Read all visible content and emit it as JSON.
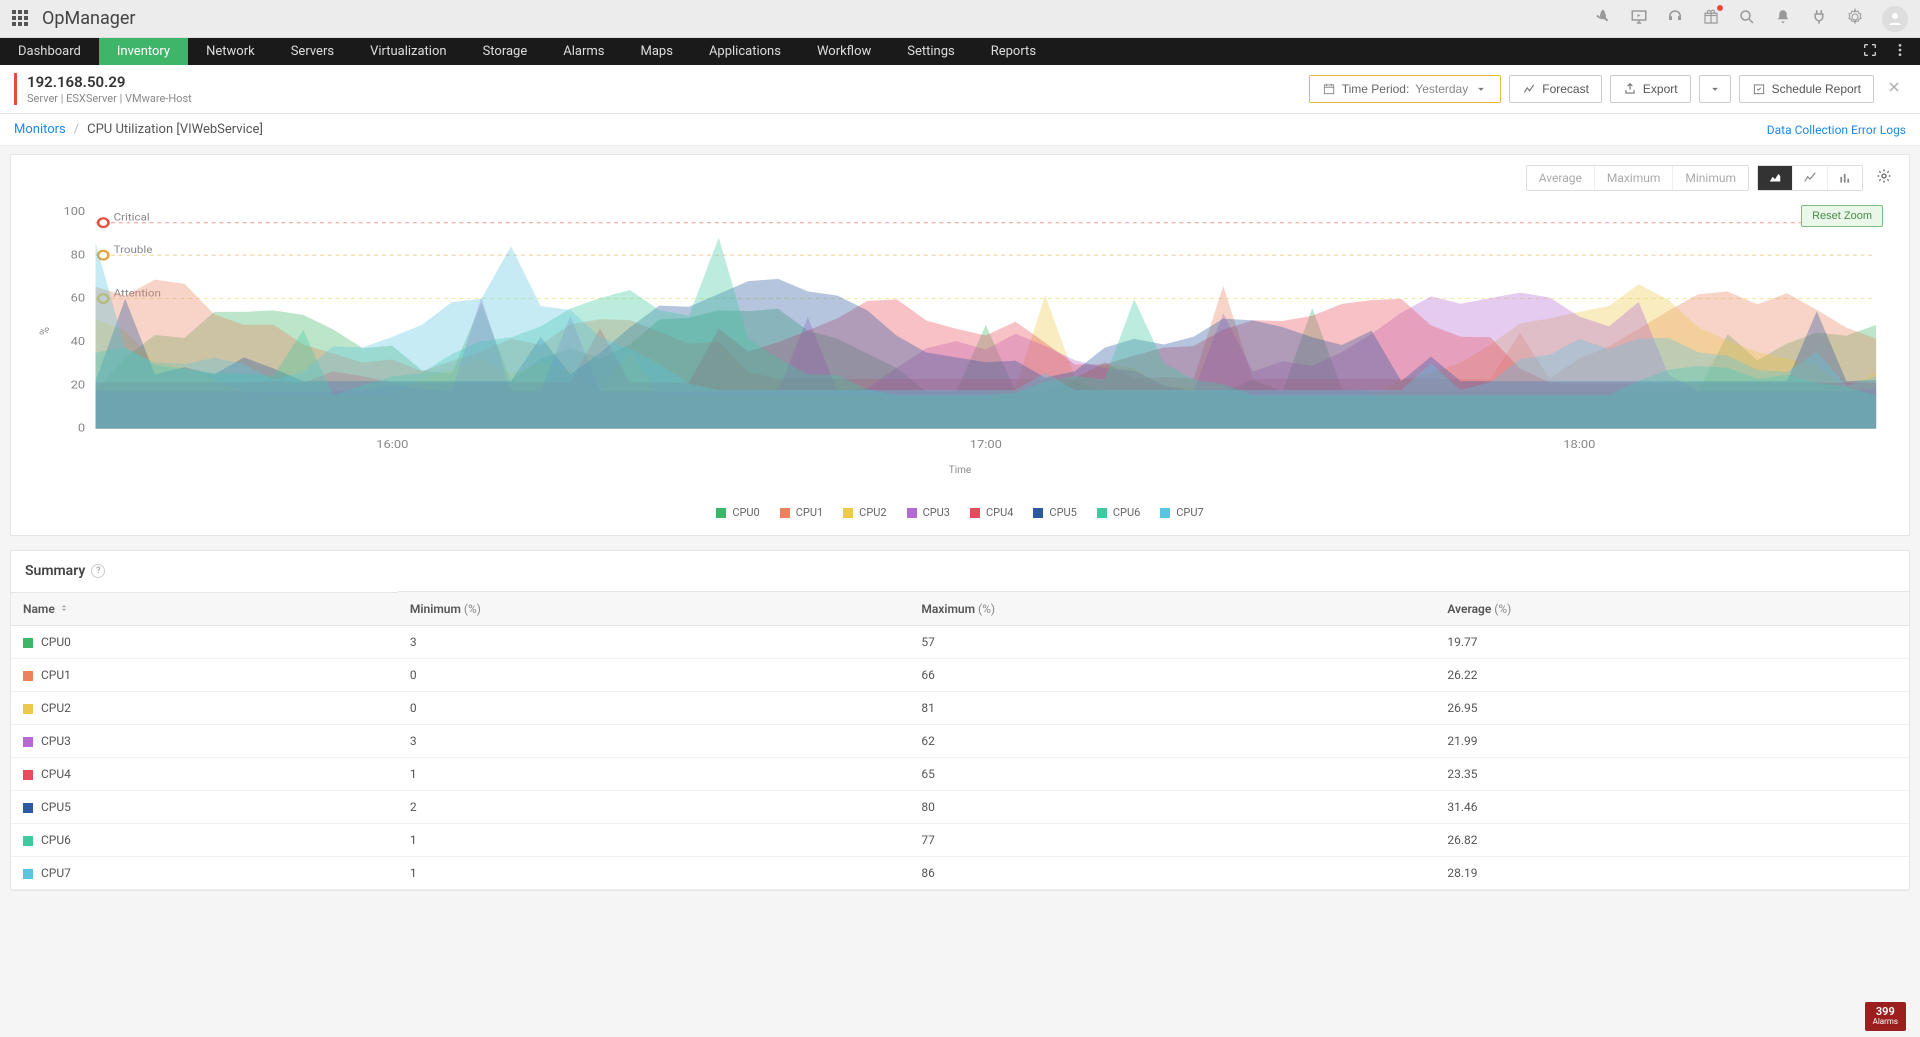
{
  "product_name": "OpManager",
  "nav": {
    "items": [
      "Dashboard",
      "Inventory",
      "Network",
      "Servers",
      "Virtualization",
      "Storage",
      "Alarms",
      "Maps",
      "Applications",
      "Workflow",
      "Settings",
      "Reports"
    ],
    "active_index": 1
  },
  "page_header": {
    "title": "192.168.50.29",
    "subtitle": "Server | ESXServer | VMware-Host",
    "time_period_label": "Time Period:",
    "time_period_value": "Yesterday",
    "forecast_label": "Forecast",
    "export_label": "Export",
    "schedule_label": "Schedule Report"
  },
  "breadcrumb": {
    "root": "Monitors",
    "current": "CPU Utilization [VIWebService]",
    "error_link": "Data Collection Error Logs"
  },
  "chart_toolbar": {
    "stats": [
      "Average",
      "Maximum",
      "Minimum"
    ],
    "reset_zoom": "Reset Zoom"
  },
  "chart_data": {
    "type": "area",
    "ylabel": "%",
    "xlabel": "Time",
    "ylim": [
      0,
      100
    ],
    "y_ticks": [
      0,
      20,
      40,
      60,
      80,
      100
    ],
    "x_ticks": [
      "16:00",
      "17:00",
      "18:00"
    ],
    "thresholds": [
      {
        "label": "Critical",
        "value": 95,
        "color": "#e74c3c"
      },
      {
        "label": "Trouble",
        "value": 80,
        "color": "#e8a33d"
      },
      {
        "label": "Attention",
        "value": 60,
        "color": "#e8d33d"
      }
    ],
    "series": [
      {
        "name": "CPU0",
        "color": "#3eb568"
      },
      {
        "name": "CPU1",
        "color": "#ec815f"
      },
      {
        "name": "CPU2",
        "color": "#ecc94b"
      },
      {
        "name": "CPU3",
        "color": "#b569d4"
      },
      {
        "name": "CPU4",
        "color": "#e74c5c"
      },
      {
        "name": "CPU5",
        "color": "#2c5aa0"
      },
      {
        "name": "CPU6",
        "color": "#3ec9a0"
      },
      {
        "name": "CPU7",
        "color": "#5bc5e0"
      }
    ]
  },
  "summary": {
    "title": "Summary",
    "columns": {
      "name": "Name",
      "min": "Minimum",
      "max": "Maximum",
      "avg": "Average",
      "unit": "(%)"
    },
    "rows": [
      {
        "name": "CPU0",
        "color": "#3eb568",
        "min": "3",
        "max": "57",
        "avg": "19.77"
      },
      {
        "name": "CPU1",
        "color": "#ec815f",
        "min": "0",
        "max": "66",
        "avg": "26.22"
      },
      {
        "name": "CPU2",
        "color": "#ecc94b",
        "min": "0",
        "max": "81",
        "avg": "26.95"
      },
      {
        "name": "CPU3",
        "color": "#b569d4",
        "min": "3",
        "max": "62",
        "avg": "21.99"
      },
      {
        "name": "CPU4",
        "color": "#e74c5c",
        "min": "1",
        "max": "65",
        "avg": "23.35"
      },
      {
        "name": "CPU5",
        "color": "#2c5aa0",
        "min": "2",
        "max": "80",
        "avg": "31.46"
      },
      {
        "name": "CPU6",
        "color": "#3ec9a0",
        "min": "1",
        "max": "77",
        "avg": "26.82"
      },
      {
        "name": "CPU7",
        "color": "#5bc5e0",
        "min": "1",
        "max": "86",
        "avg": "28.19"
      }
    ]
  },
  "alarm_widget": {
    "count": "399",
    "label": "Alarms"
  }
}
